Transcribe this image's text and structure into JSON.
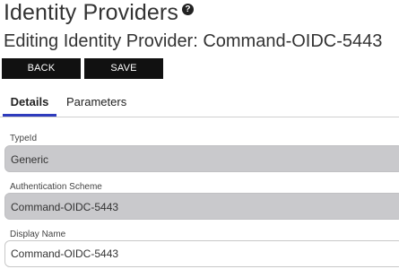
{
  "header": {
    "title": "Identity Providers",
    "help_icon": "?",
    "subtitle": "Editing Identity Provider: Command-OIDC-5443"
  },
  "toolbar": {
    "back_label": "BACK",
    "save_label": "SAVE"
  },
  "tabs": [
    {
      "label": "Details",
      "active": true
    },
    {
      "label": "Parameters",
      "active": false
    }
  ],
  "form": {
    "type_id": {
      "label": "TypeId",
      "value": "Generic"
    },
    "auth_scheme": {
      "label": "Authentication Scheme",
      "value": "Command-OIDC-5443"
    },
    "display_name": {
      "label": "Display Name",
      "value": "Command-OIDC-5443"
    }
  },
  "colors": {
    "button_bg": "#111111",
    "tab_active_underline": "#2e3bbd",
    "readonly_field_bg": "#c9c9cc"
  }
}
